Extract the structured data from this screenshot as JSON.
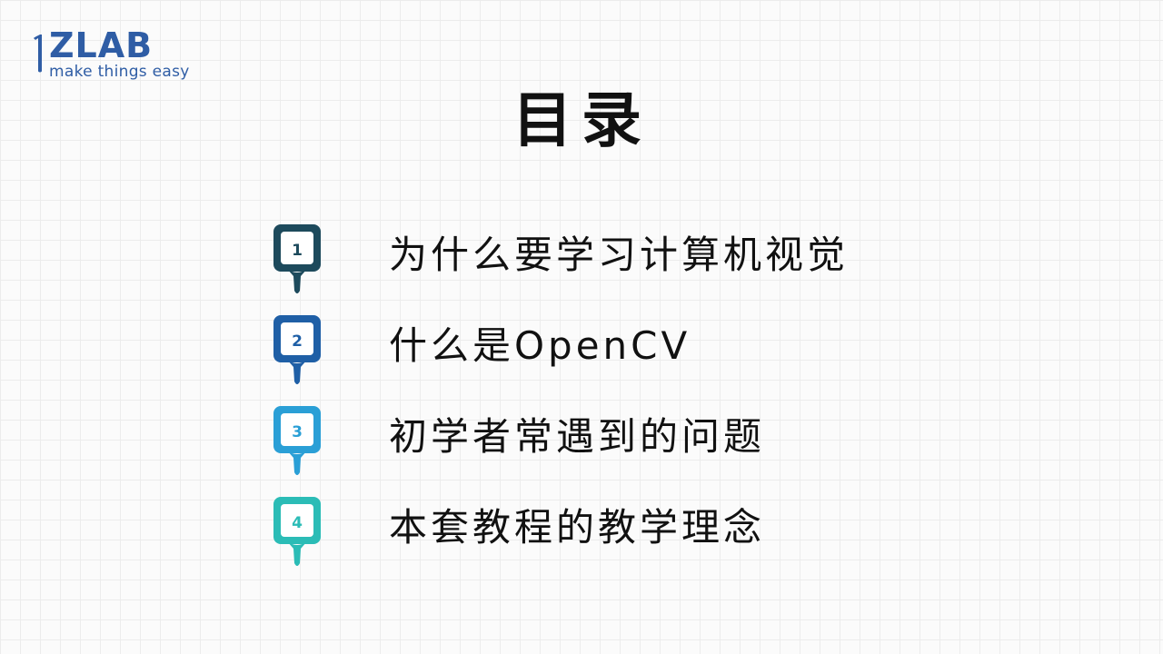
{
  "logo": {
    "wordmark": "ZLAB",
    "tagline": "make things easy",
    "color": "#2f5da5"
  },
  "title": "目录",
  "items": [
    {
      "number": "1",
      "label": "为什么要学习计算机视觉",
      "color": "#1d4a5c"
    },
    {
      "number": "2",
      "label": "什么是OpenCV",
      "color": "#1f5fa6"
    },
    {
      "number": "3",
      "label": "初学者常遇到的问题",
      "color": "#2a9fd6"
    },
    {
      "number": "4",
      "label": "本套教程的教学理念",
      "color": "#2bbcb6"
    }
  ],
  "badge_icon": "dripping-sign-icon"
}
